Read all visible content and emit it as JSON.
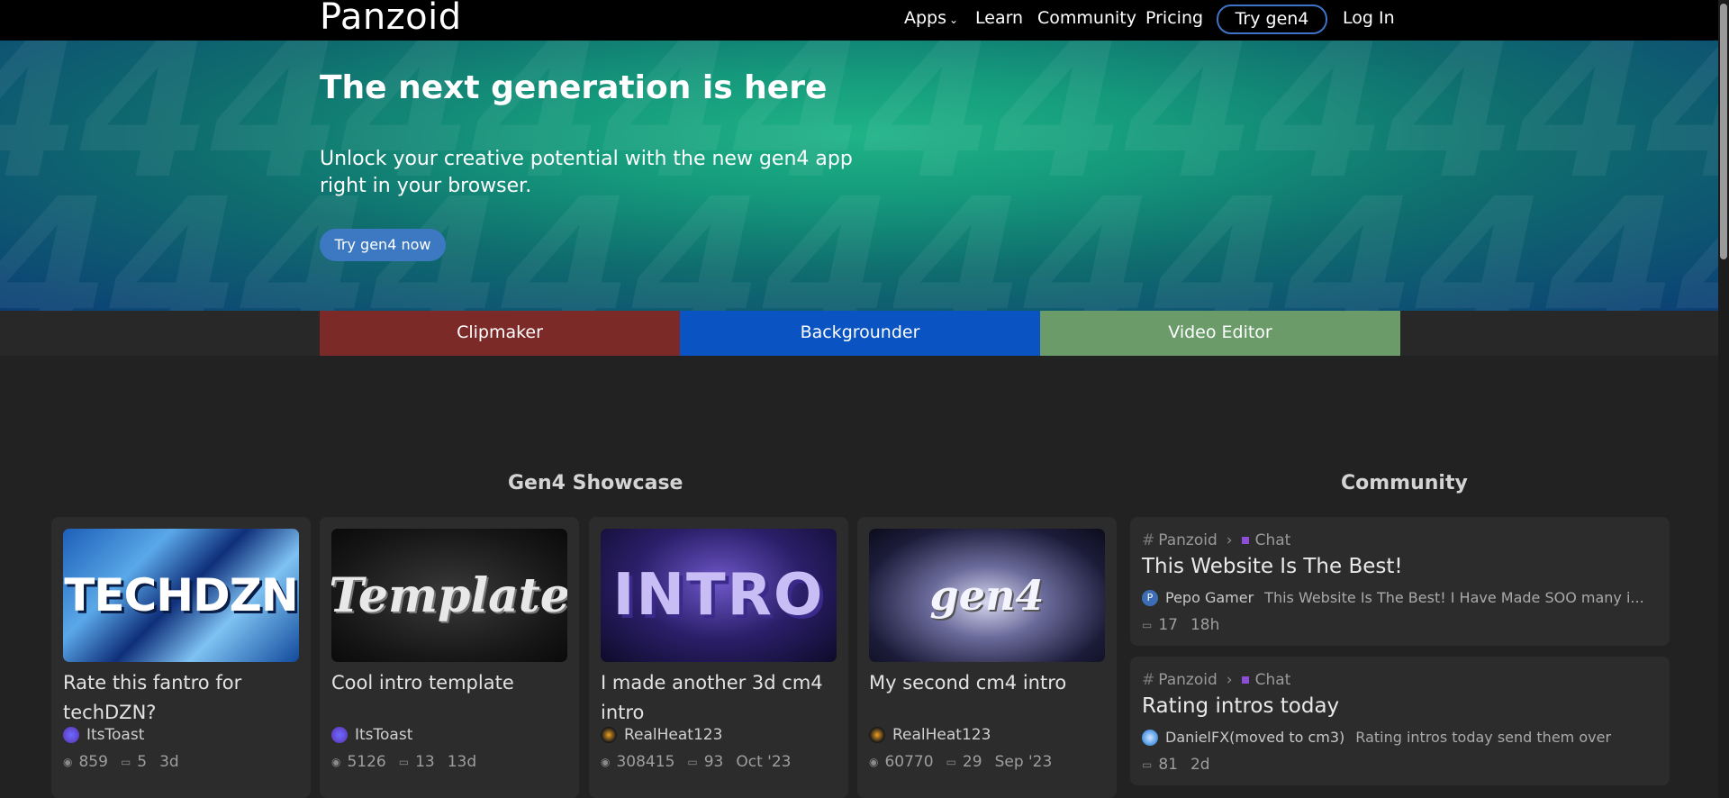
{
  "nav": {
    "logo": "Panzoid",
    "apps": "Apps",
    "learn": "Learn",
    "community": "Community",
    "pricing": "Pricing",
    "try": "Try gen4",
    "login": "Log In"
  },
  "hero": {
    "title": "The next generation is here",
    "subtitle": "Unlock your creative potential with the new gen4 app right in your browser.",
    "button": "Try gen4 now",
    "pattern_glyph": "4"
  },
  "apps": [
    {
      "label": "Clipmaker",
      "color": "#7b2a28"
    },
    {
      "label": "Backgrounder",
      "color": "#0a53c2"
    },
    {
      "label": "Video Editor",
      "color": "#6a9b68"
    }
  ],
  "showcase": {
    "title": "Gen4 Showcase",
    "cards": [
      {
        "thumb_text": "TECHDZN",
        "title": "Rate this fantro for techDZN?",
        "author": "ItsToast",
        "views": "859",
        "comments": "5",
        "age": "3d"
      },
      {
        "thumb_text": "Template",
        "title": "Cool intro template",
        "author": "ItsToast",
        "views": "5126",
        "comments": "13",
        "age": "13d"
      },
      {
        "thumb_text": "INTRO",
        "title": "I made another 3d cm4 intro",
        "author": "RealHeat123",
        "views": "308415",
        "comments": "93",
        "age": "Oct '23"
      },
      {
        "thumb_text": "gen4",
        "title": "My second cm4 intro",
        "author": "RealHeat123",
        "views": "60770",
        "comments": "29",
        "age": "Sep '23"
      }
    ]
  },
  "community": {
    "title": "Community",
    "posts": [
      {
        "category": "Panzoid",
        "channel": "Chat",
        "title": "This Website Is The Best!",
        "author_initial": "P",
        "author": "Pepo Gamer",
        "excerpt": "This Website Is The Best! I Have Made SOO many i...",
        "replies": "17",
        "age": "18h"
      },
      {
        "category": "Panzoid",
        "channel": "Chat",
        "title": "Rating intros today",
        "author": "DanielFX(moved to cm3)",
        "excerpt": "Rating intros today send them over",
        "replies": "81",
        "age": "2d"
      }
    ]
  }
}
